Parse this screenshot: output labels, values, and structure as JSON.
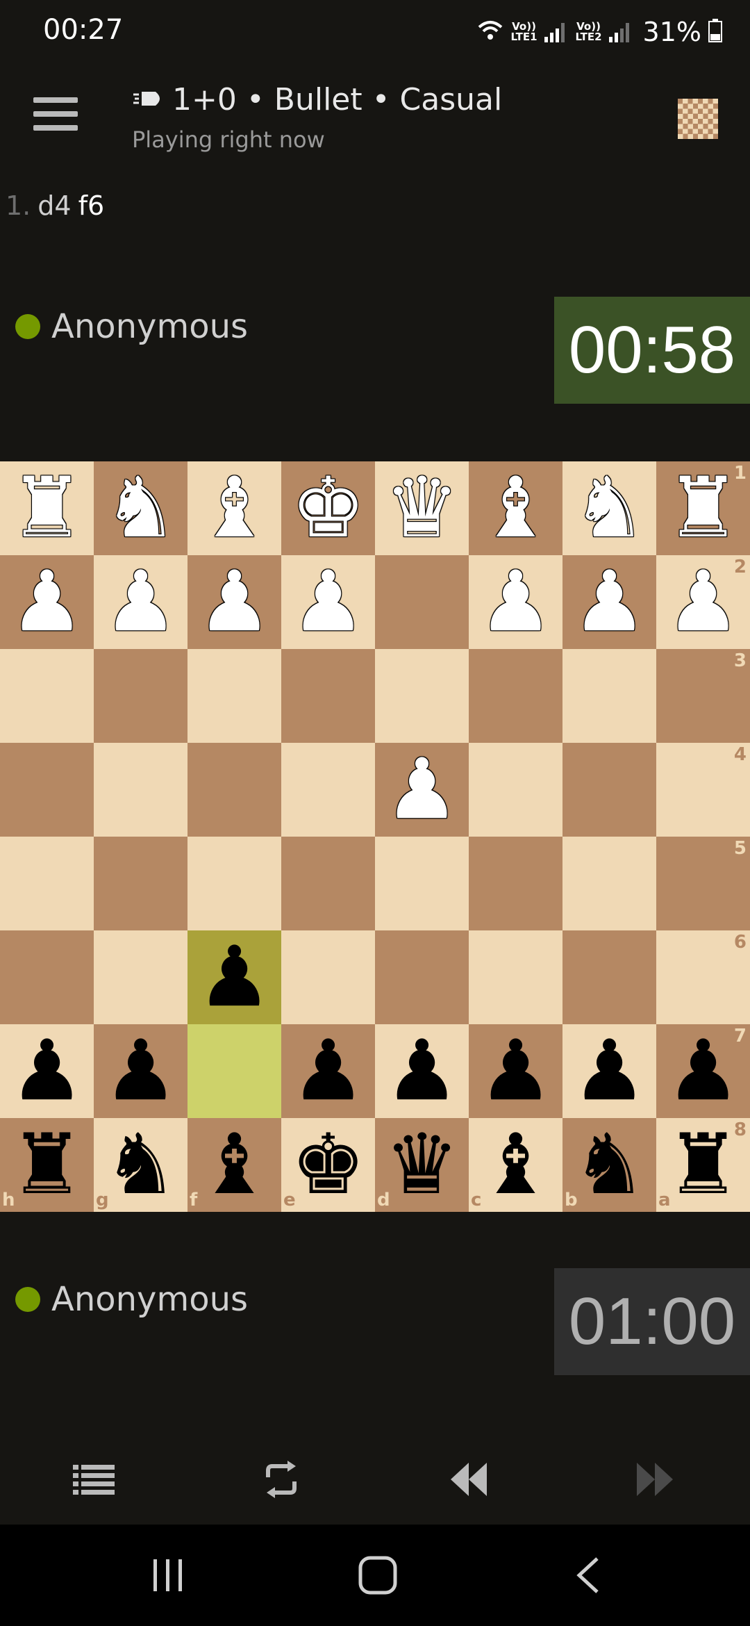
{
  "status_bar": {
    "time": "00:27",
    "sim1_top": "Vo))",
    "sim1_bottom": "LTE1",
    "sim2_top": "Vo))",
    "sim2_bottom": "LTE2",
    "battery": "31%"
  },
  "header": {
    "title": "1+0 • Bullet • Casual",
    "subtitle": "Playing right now",
    "icon": "bullet-icon"
  },
  "moves": {
    "number": "1.",
    "white": "d4",
    "black": "f6"
  },
  "players": {
    "top": {
      "name": "Anonymous",
      "clock": "00:58",
      "status_color": "#759900"
    },
    "bottom": {
      "name": "Anonymous",
      "clock": "01:00",
      "status_color": "#759900"
    }
  },
  "board": {
    "orientation": "black",
    "ranks": [
      "1",
      "2",
      "3",
      "4",
      "5",
      "6",
      "7",
      "8"
    ],
    "files": [
      "h",
      "g",
      "f",
      "e",
      "d",
      "c",
      "b",
      "a"
    ],
    "rows": [
      [
        "wR",
        "wN",
        "wB",
        "wK",
        "wQ",
        "wB",
        "wN",
        "wR"
      ],
      [
        "wP",
        "wP",
        "wP",
        "wP",
        "",
        "wP",
        "wP",
        "wP"
      ],
      [
        "",
        "",
        "",
        "",
        "",
        "",
        "",
        ""
      ],
      [
        "",
        "",
        "",
        "",
        "wP",
        "",
        "",
        ""
      ],
      [
        "",
        "",
        "",
        "",
        "",
        "",
        "",
        ""
      ],
      [
        "",
        "",
        "bP",
        "",
        "",
        "",
        "",
        ""
      ],
      [
        "bP",
        "bP",
        "",
        "bP",
        "bP",
        "bP",
        "bP",
        "bP"
      ],
      [
        "bR",
        "bN",
        "bB",
        "bK",
        "bQ",
        "bB",
        "bN",
        "bR"
      ]
    ],
    "last_move": {
      "from": "f7",
      "to": "f6"
    },
    "colors": {
      "light": "#f0d9b5",
      "dark": "#b58863",
      "highlight_from": "#cdd26a",
      "highlight_to": "#aaa23a"
    }
  },
  "toolbar": {
    "items": [
      "moves-list-icon",
      "flip-board-icon",
      "back-icon",
      "forward-icon"
    ]
  }
}
